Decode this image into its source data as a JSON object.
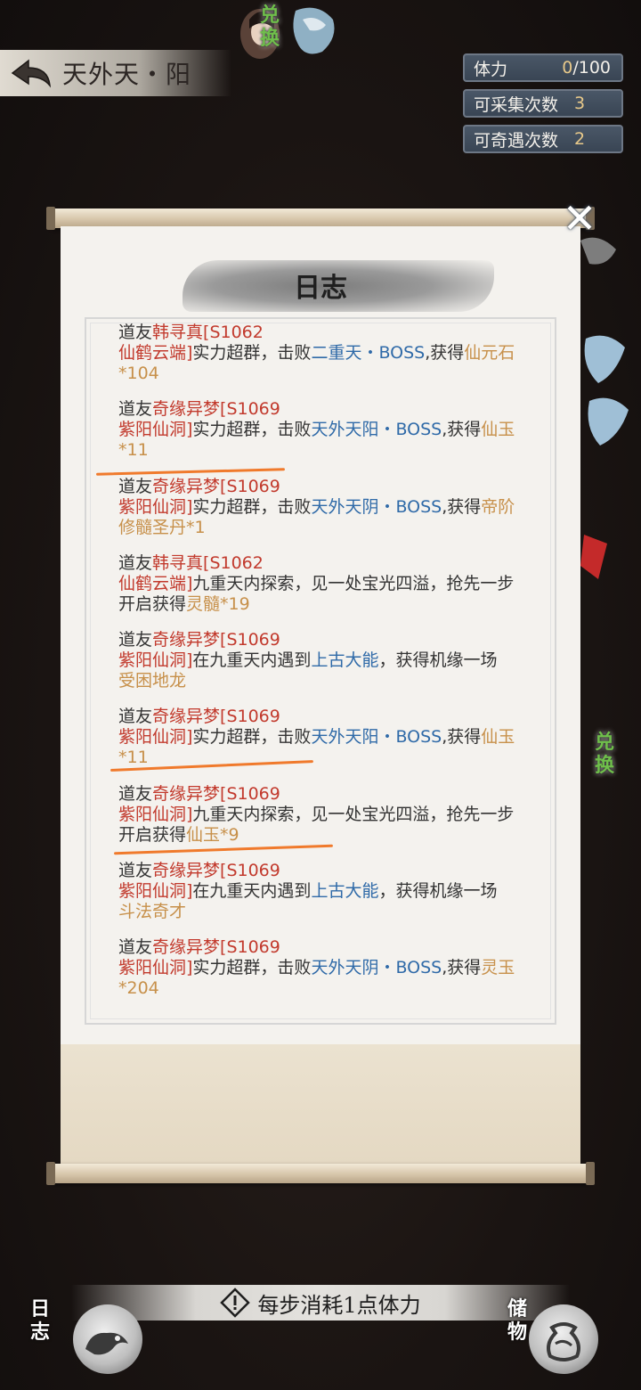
{
  "header": {
    "location": "天外天・阳",
    "exchange_label": "兑换",
    "stats": [
      {
        "label": "体力",
        "value": "0",
        "max": "/100"
      },
      {
        "label": "可采集次数",
        "value": "3",
        "max": ""
      },
      {
        "label": "可奇遇次数",
        "value": "2",
        "max": ""
      }
    ]
  },
  "log": {
    "title": "日志",
    "entries": [
      {
        "prefix": "道友",
        "name": "韩寻真",
        "server": "[S1062",
        "cave": "仙鹤云端]",
        "text1": "实力超群，击败",
        "target": "二重天・BOSS",
        "text2": ",获得",
        "reward": "仙元石*104"
      },
      {
        "prefix": "道友",
        "name": "奇缘异梦",
        "server": "[S1069",
        "cave": "紫阳仙洞]",
        "text1": "实力超群，击败",
        "target": "天外天阳・BOSS",
        "text2": ",获得",
        "reward": "仙玉*11"
      },
      {
        "prefix": "道友",
        "name": "奇缘异梦",
        "server": "[S1069",
        "cave": "紫阳仙洞]",
        "text1": "实力超群，击败",
        "target": "天外天阴・BOSS",
        "text2": ",获得",
        "reward": "帝阶修髓圣丹*1"
      },
      {
        "prefix": "道友",
        "name": "韩寻真",
        "server": "[S1062",
        "cave": "仙鹤云端]",
        "text1": "九重天内探索，见一处宝光四溢，抢先一步开启获得",
        "target": "",
        "text2": "",
        "reward": "灵髓*19"
      },
      {
        "prefix": "道友",
        "name": "奇缘异梦",
        "server": "[S1069",
        "cave": "紫阳仙洞]",
        "text1": "在九重天内遇到",
        "target": "上古大能",
        "text2": "，获得机缘一场",
        "reward": "受困地龙"
      },
      {
        "prefix": "道友",
        "name": "奇缘异梦",
        "server": "[S1069",
        "cave": "紫阳仙洞]",
        "text1": "实力超群，击败",
        "target": "天外天阳・BOSS",
        "text2": ",获得",
        "reward": "仙玉*11"
      },
      {
        "prefix": "道友",
        "name": "奇缘异梦",
        "server": "[S1069",
        "cave": "紫阳仙洞]",
        "text1": "九重天内探索，见一处宝光四溢，抢先一步开启获得",
        "target": "",
        "text2": "",
        "reward": "仙玉*9"
      },
      {
        "prefix": "道友",
        "name": "奇缘异梦",
        "server": "[S1069",
        "cave": "紫阳仙洞]",
        "text1": "在九重天内遇到",
        "target": "上古大能",
        "text2": "，获得机缘一场",
        "reward": "斗法奇才"
      },
      {
        "prefix": "道友",
        "name": "奇缘异梦",
        "server": "[S1069",
        "cave": "紫阳仙洞]",
        "text1": "实力超群，击败",
        "target": "天外天阴・BOSS",
        "text2": ",获得",
        "reward": "灵玉*204"
      }
    ]
  },
  "footer": {
    "cost_text": "每步消耗1点体力",
    "log_button": "日志",
    "storage_button": "储物"
  },
  "colors": {
    "player": "#c23a2d",
    "target": "#2f6aa8",
    "reward": "#c7904a",
    "annotation": "#f07a2c"
  },
  "icons": [
    "back-arrow-icon",
    "close-icon",
    "warning-icon",
    "dragon-icon",
    "bag-icon"
  ]
}
